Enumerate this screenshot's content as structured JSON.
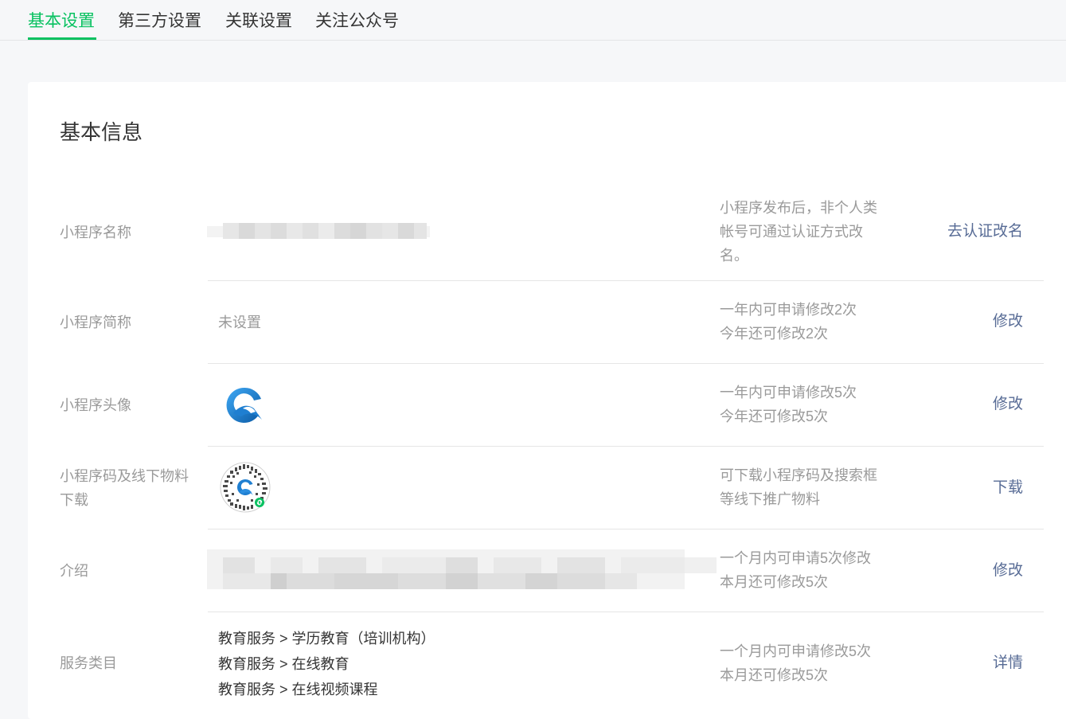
{
  "tabs": [
    {
      "label": "基本设置",
      "active": true
    },
    {
      "label": "第三方设置",
      "active": false
    },
    {
      "label": "关联设置",
      "active": false
    },
    {
      "label": "关注公众号",
      "active": false
    }
  ],
  "section_title": "基本信息",
  "rows": {
    "name": {
      "label": "小程序名称",
      "tip": "小程序发布后，非个人类帐号可通过认证方式改名。",
      "action": "去认证改名"
    },
    "short_name": {
      "label": "小程序简称",
      "value": "未设置",
      "tip_line1": "一年内可申请修改2次",
      "tip_line2": "今年还可修改2次",
      "action": "修改"
    },
    "avatar": {
      "label": "小程序头像",
      "icon": "app-logo-icon",
      "tip_line1": "一年内可申请修改5次",
      "tip_line2": "今年还可修改5次",
      "action": "修改"
    },
    "qrcode": {
      "label_line1": "小程序码及线下物料",
      "label_line2": "下载",
      "icon": "mini-program-code-icon",
      "tip_line1": "可下载小程序码及搜索框",
      "tip_line2": "等线下推广物料",
      "action": "下载"
    },
    "intro": {
      "label": "介绍",
      "tip_line1": "一个月内可申请5次修改",
      "tip_line2": "本月还可修改5次",
      "action": "修改"
    },
    "category": {
      "label": "服务类目",
      "items": [
        "教育服务 > 学历教育（培训机构）",
        "教育服务 > 在线教育",
        "教育服务 > 在线视频课程"
      ],
      "tip_line1": "一个月内可申请修改5次",
      "tip_line2": "本月还可修改5次",
      "action": "详情"
    }
  },
  "colors": {
    "accent": "#07c160",
    "link": "#576b95",
    "muted": "#9a9a9a",
    "text": "#353535"
  }
}
